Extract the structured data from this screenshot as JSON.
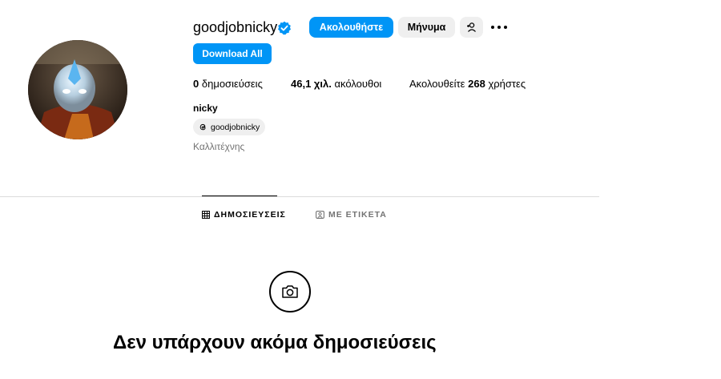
{
  "profile": {
    "username": "goodjobnicky",
    "display_name": "nicky",
    "threads_handle": "goodjobnicky",
    "category": "Καλλιτέχνης"
  },
  "actions": {
    "follow_label": "Ακολουθήστε",
    "message_label": "Μήνυμα",
    "download_label": "Download All"
  },
  "stats": {
    "posts_count": "0",
    "posts_label": "δημοσιεύσεις",
    "followers_count": "46,1 χιλ.",
    "followers_label": "ακόλουθοι",
    "following_prefix": "Ακολουθείτε",
    "following_count": "268",
    "following_suffix": "χρήστες"
  },
  "tabs": [
    {
      "label": "ΔΗΜΟΣΙΕΥΣΕΙΣ",
      "active": true
    },
    {
      "label": "ΜΕ ΕΤΙΚΕΤΑ",
      "active": false
    }
  ],
  "empty_state": {
    "title": "Δεν υπάρχουν ακόμα δημοσιεύσεις"
  },
  "colors": {
    "accent": "#0095f6",
    "secondary_button": "#efefef",
    "muted_text": "#737373"
  }
}
